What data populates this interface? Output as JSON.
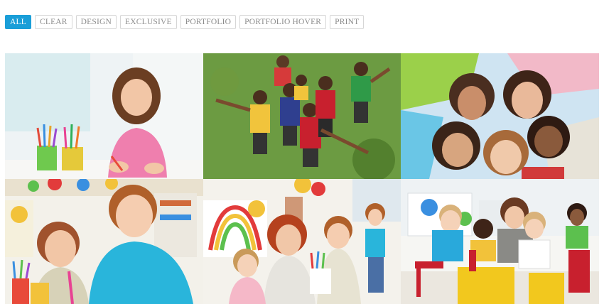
{
  "filters": {
    "active": "ALL",
    "items": [
      {
        "label": "ALL"
      },
      {
        "label": "CLEAR"
      },
      {
        "label": "DESIGN"
      },
      {
        "label": "EXCLUSIVE"
      },
      {
        "label": "PORTFOLIO"
      },
      {
        "label": "PORTFOLIO HOVER"
      },
      {
        "label": "PRINT"
      }
    ]
  },
  "portfolio": {
    "items": [
      {
        "image": "girl-drawing-crayons-photo"
      },
      {
        "image": "kids-group-on-grass-photo"
      },
      {
        "image": "kids-circle-looking-down-photo"
      },
      {
        "image": "boys-coloring-classroom-photo"
      },
      {
        "image": "teacher-with-kids-painting-photo"
      },
      {
        "image": "classroom-kids-yellow-tables-photo"
      }
    ]
  },
  "colors": {
    "accent": "#1a9ed8"
  }
}
